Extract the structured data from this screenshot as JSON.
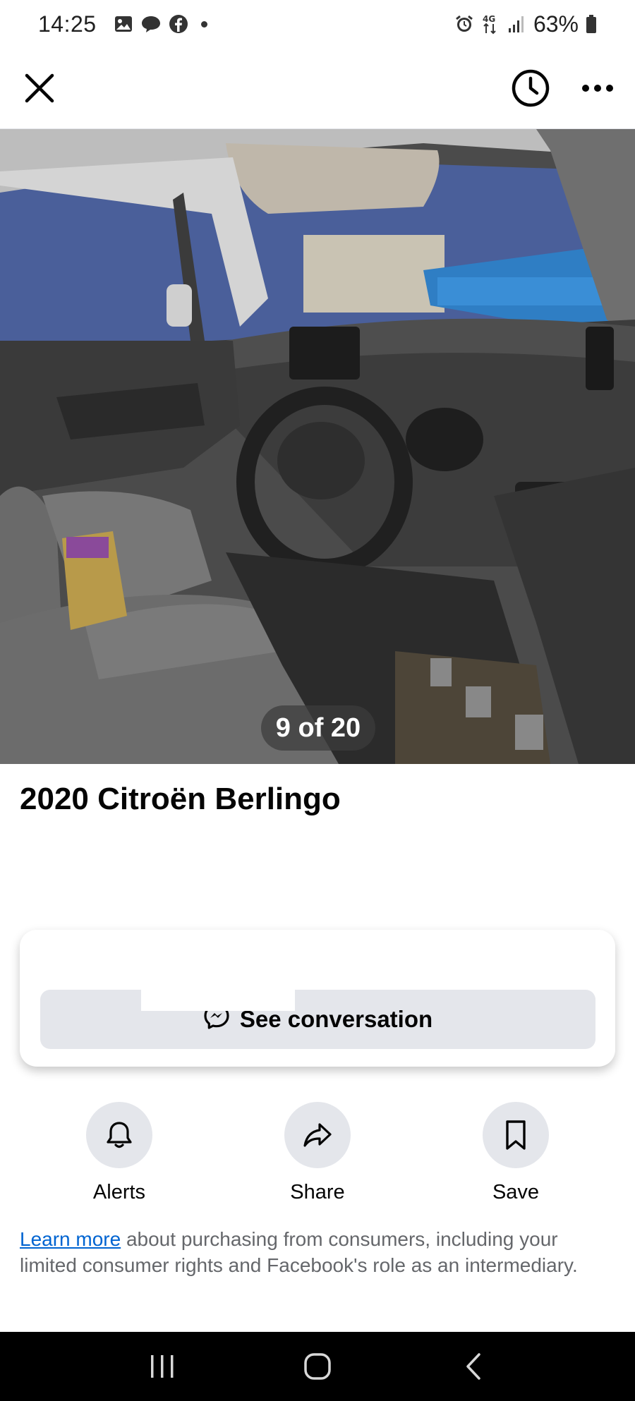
{
  "status_bar": {
    "time": "14:25",
    "left_icons": [
      "gallery-icon",
      "messages-icon",
      "facebook-icon",
      "notification-dot"
    ],
    "right_icons": [
      "alarm-icon",
      "4g-icon",
      "signal-icon",
      "battery-icon"
    ],
    "network": "4G",
    "battery": "63%"
  },
  "top_bar": {
    "close_icon": "close-icon",
    "history_icon": "clock-icon",
    "more_icon": "more-icon"
  },
  "photo": {
    "counter": "9 of 20",
    "current": 9,
    "total": 20
  },
  "listing": {
    "title": "2020 Citroën Berlingo"
  },
  "conversation": {
    "button_label": "See conversation",
    "icon": "messenger-icon"
  },
  "actions": [
    {
      "label": "Alerts",
      "icon": "bell-icon"
    },
    {
      "label": "Share",
      "icon": "share-icon"
    },
    {
      "label": "Save",
      "icon": "bookmark-icon"
    }
  ],
  "disclaimer": {
    "link": "Learn more",
    "text": " about purchasing from consumers, including your limited consumer rights and Facebook's role as an intermediary."
  },
  "nav_bar": {
    "icons": [
      "recent-apps-icon",
      "home-icon",
      "back-icon"
    ]
  },
  "colors": {
    "link": "#0064d1",
    "button_bg": "#e4e6eb",
    "text_secondary": "#65676b"
  }
}
